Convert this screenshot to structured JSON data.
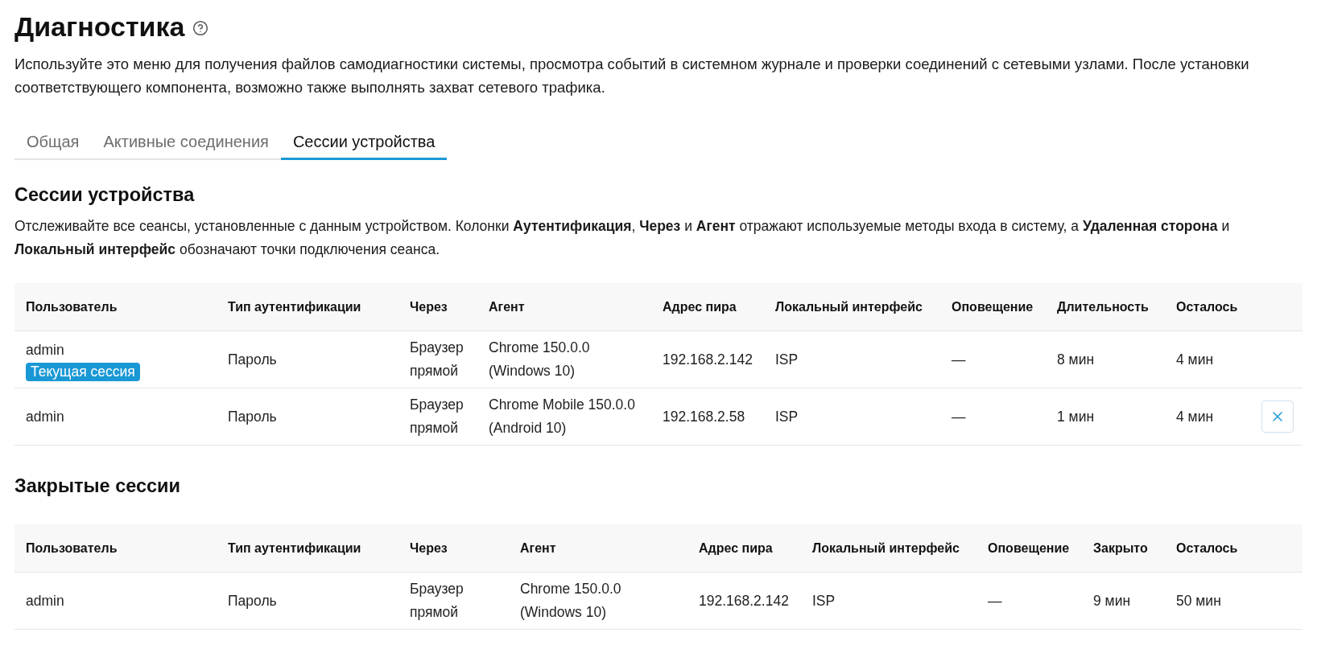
{
  "page": {
    "title": "Диагностика",
    "description": "Используйте это меню для получения файлов самодиагностики системы, просмотра событий в системном журнале и проверки соединений с сетевыми узлами. После установки соответствующего компонента, возможно также выполнять захват сетевого трафика."
  },
  "tabs": [
    {
      "label": "Общая",
      "selected": false
    },
    {
      "label": "Активные соединения",
      "selected": false
    },
    {
      "label": "Сессии устройства",
      "selected": true
    }
  ],
  "sections": [
    {
      "heading": "Сессии устройства",
      "description": "Отслеживайте все сеансы, установленные с данным устройством. Колонки **Аутентификация**, **Через** и **Агент** отражают используемые методы входа в систему, а **Удаленная сторона** и **Локальный интерфейс** обозначают точки подключения сеанса.",
      "table": {
        "columns": [
          "Пользователь",
          "Тип аутентификации",
          "Через",
          "Агент",
          "Адрес пира",
          "Локальный интерфейс",
          "Оповещение",
          "Длительность",
          "Осталось"
        ],
        "rows": [
          {
            "cells": [
              "admin",
              "Пароль",
              "Браузер прямой",
              "Chrome 150.0.0 (Windows 10)",
              "192.168.2.142",
              "ISP",
              "—",
              "8 мин",
              "4 мин"
            ],
            "badge": "Текущая сессия",
            "closable": false
          },
          {
            "cells": [
              "admin",
              "Пароль",
              "Браузер прямой",
              "Chrome Mobile 150.0.0 (Android 10)",
              "192.168.2.58",
              "ISP",
              "—",
              "1 мин",
              "4 мин"
            ],
            "closable": true
          }
        ]
      }
    },
    {
      "heading": "Закрытые сессии",
      "table": {
        "columns": [
          "Пользователь",
          "Тип аутентификации",
          "Через",
          "Агент",
          "Адрес пира",
          "Локальный интерфейс",
          "Оповещение",
          "Закрыто",
          "Осталось"
        ],
        "rows": [
          {
            "cells": [
              "admin",
              "Пароль",
              "Браузер прямой",
              "Chrome 150.0.0 (Windows 10)",
              "192.168.2.142",
              "ISP",
              "—",
              "9 мин",
              "50 мин"
            ]
          }
        ]
      }
    }
  ]
}
